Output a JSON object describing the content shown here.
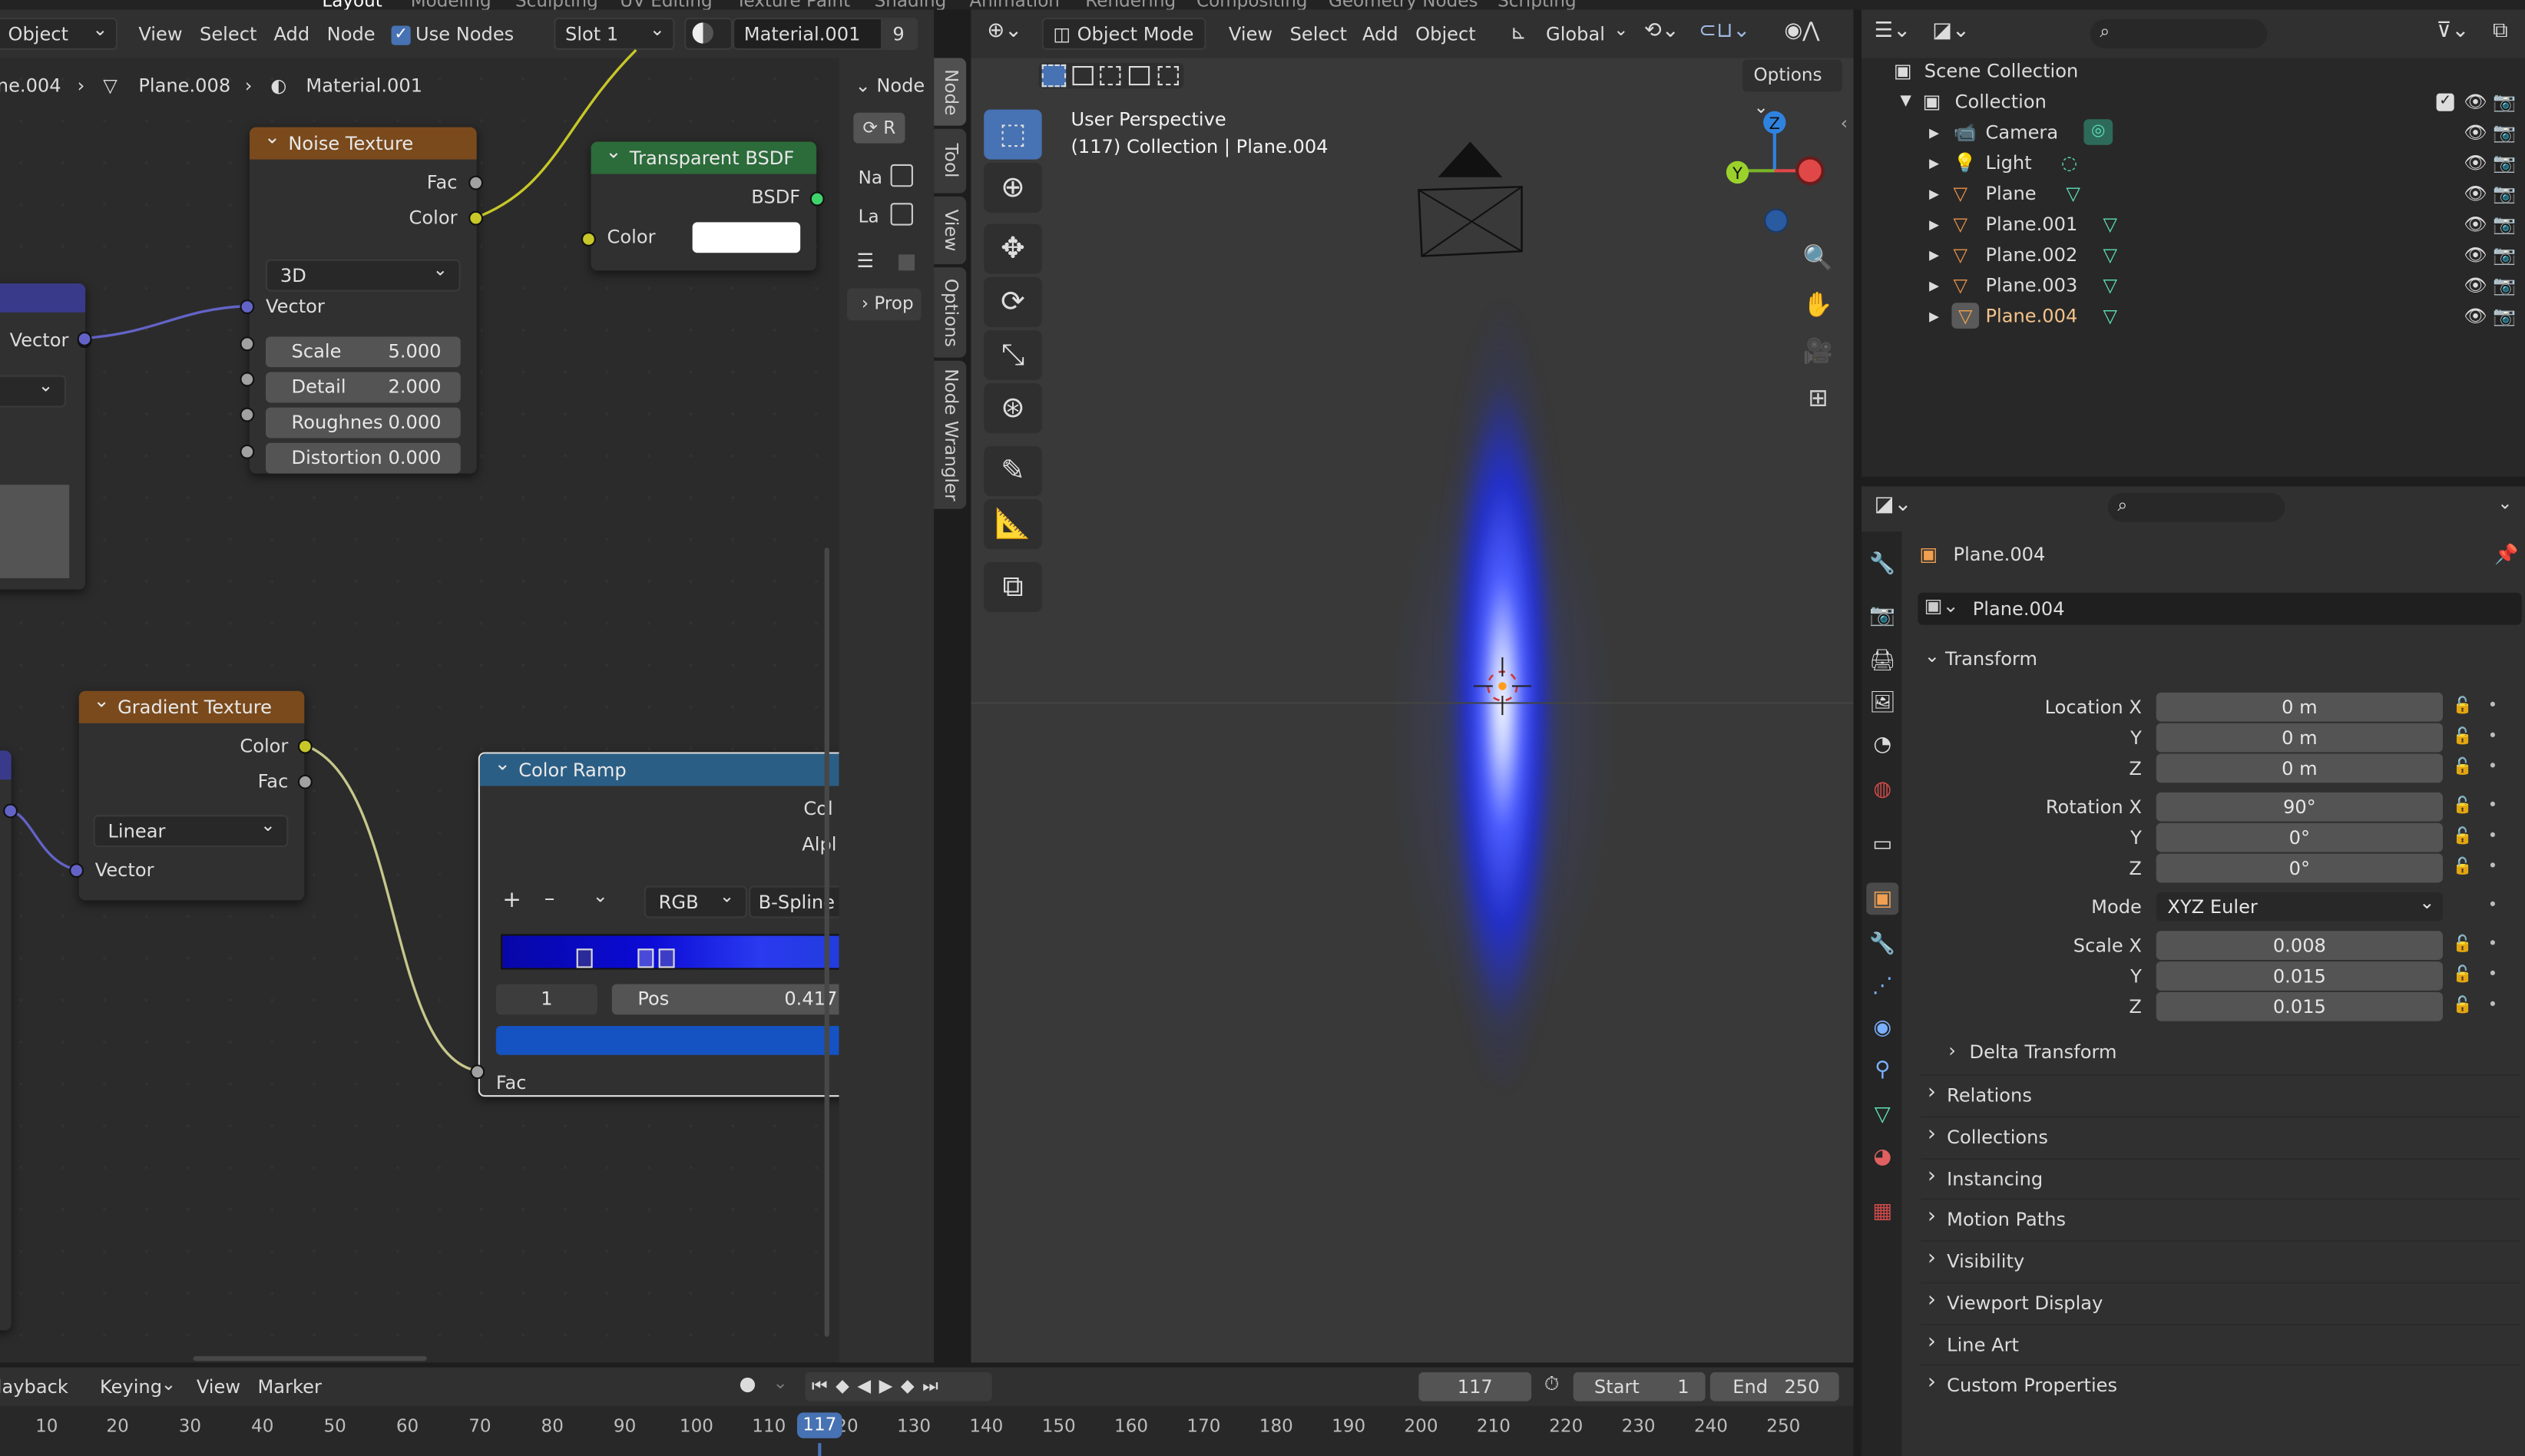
{
  "top_tabs": [
    "Layout",
    "Modeling",
    "Sculpting",
    "UV Editing",
    "Texture Paint",
    "Shading",
    "Animation",
    "Rendering",
    "Compositing",
    "Geometry Nodes",
    "Scripting"
  ],
  "node_editor": {
    "mode_label": "Object",
    "menus": [
      "View",
      "Select",
      "Add",
      "Node"
    ],
    "use_nodes_label": "Use Nodes",
    "slot_label": "Slot 1",
    "material_name": "Material.001",
    "user_count": "9",
    "breadcrumb": [
      "ne.004",
      "Plane.008",
      "Material.001"
    ],
    "sidebar": {
      "node_tab": "Node",
      "refresh": "R",
      "name_short": "Na",
      "label_short": "La",
      "prop": "Prop"
    },
    "vertical_tabs": [
      "Node",
      "Tool",
      "View",
      "Options",
      "Node Wrangler"
    ]
  },
  "nodes": {
    "noise": {
      "title": "Noise Texture",
      "out_fac": "Fac",
      "out_color": "Color",
      "dimension": "3D",
      "in_vector": "Vector",
      "fields": [
        {
          "label": "Scale",
          "value": "5.000"
        },
        {
          "label": "Detail",
          "value": "2.000"
        },
        {
          "label": "Roughnes",
          "value": "0.000"
        },
        {
          "label": "Distortion",
          "value": "0.000"
        }
      ]
    },
    "transparent": {
      "title": "Transparent BSDF",
      "out_bsdf": "BSDF",
      "in_color": "Color",
      "color_swatch": "#ffffff"
    },
    "left_partial": {
      "vector": "Vector"
    },
    "gradient": {
      "title": "Gradient Texture",
      "out_color": "Color",
      "out_fac": "Fac",
      "type": "Linear",
      "in_vector": "Vector"
    },
    "ramp": {
      "title": "Color Ramp",
      "out_color": "Col",
      "out_alpha": "Alpl",
      "add": "+",
      "remove": "–",
      "more": "⌄",
      "mode": "RGB",
      "interp": "B-Spline",
      "index": "1",
      "pos_label": "Pos",
      "pos_value": "0.417",
      "in_fac": "Fac",
      "stops": [
        0.2,
        0.35,
        0.39
      ]
    }
  },
  "viewport": {
    "mode_label": "Object Mode",
    "menus": [
      "View",
      "Select",
      "Add",
      "Object"
    ],
    "orientation": "Global",
    "options": "Options",
    "info_line1": "User Perspective",
    "info_line2": "(117) Collection | Plane.004",
    "axes": [
      "Z",
      "Y",
      "X"
    ]
  },
  "outliner": {
    "scene_collection": "Scene Collection",
    "collection": "Collection",
    "items": [
      "Camera",
      "Light",
      "Plane",
      "Plane.001",
      "Plane.002",
      "Plane.003",
      "Plane.004"
    ]
  },
  "properties": {
    "object_name": "Plane.004",
    "data_name": "Plane.004",
    "transform_title": "Transform",
    "location": {
      "label": "Location X",
      "x": "0 m",
      "y": "0 m",
      "z": "0 m"
    },
    "rotation": {
      "label": "Rotation X",
      "x": "90°",
      "y": "0°",
      "z": "0°"
    },
    "mode_label": "Mode",
    "mode_value": "XYZ Euler",
    "scale": {
      "label": "Scale X",
      "x": "0.008",
      "y": "0.015",
      "z": "0.015"
    },
    "axis_y": "Y",
    "axis_z": "Z",
    "delta": "Delta Transform",
    "sections": [
      "Relations",
      "Collections",
      "Instancing",
      "Motion Paths",
      "Visibility",
      "Viewport Display",
      "Line Art",
      "Custom Properties"
    ]
  },
  "timeline": {
    "menus": [
      "layback",
      "Keying",
      "View",
      "Marker"
    ],
    "current_frame": "117",
    "start_label": "Start",
    "start_value": "1",
    "end_label": "End",
    "end_value": "250",
    "ticks": [
      "10",
      "20",
      "30",
      "40",
      "50",
      "60",
      "70",
      "80",
      "90",
      "100",
      "110",
      "120",
      "130",
      "140",
      "150",
      "160",
      "170",
      "180",
      "190",
      "200",
      "210",
      "220",
      "230",
      "240",
      "250"
    ]
  },
  "colors": {
    "noise_header": "#7a4a1c",
    "gradient_header": "#7a4a1c",
    "transparent_header": "#2c6b3a",
    "ramp_header": "#2b5e85",
    "accent": "#4772b3"
  }
}
